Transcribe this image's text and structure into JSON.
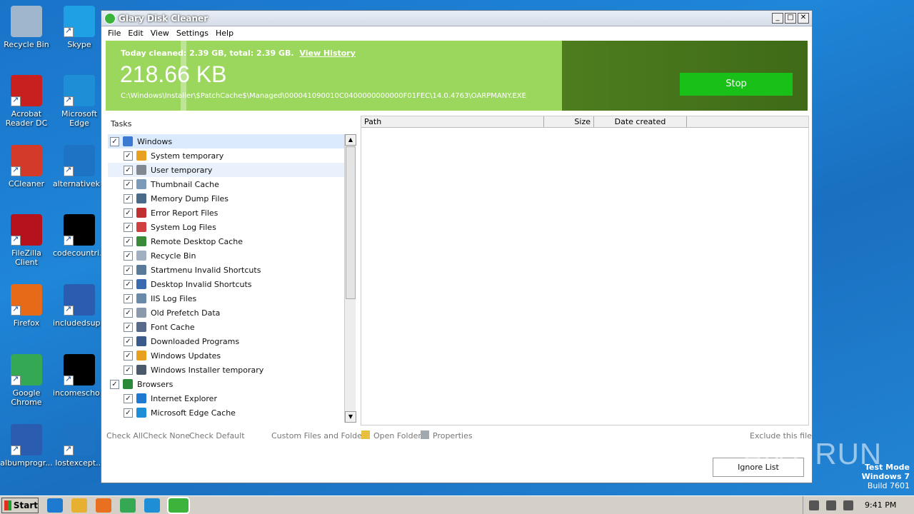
{
  "desktop": {
    "icons": [
      {
        "label": "Recycle Bin",
        "color": "#9fb6cc"
      },
      {
        "label": "Skype",
        "color": "#1fa0e4"
      },
      {
        "label": "Acrobat Reader DC",
        "color": "#c8201e"
      },
      {
        "label": "Microsoft Edge",
        "color": "#1e8fd6"
      },
      {
        "label": "CCleaner",
        "color": "#d43a2a"
      },
      {
        "label": "alternativeki...",
        "color": "#1e74c4"
      },
      {
        "label": "FileZilla Client",
        "color": "#b5121b"
      },
      {
        "label": "codecountri...",
        "color": "#000000"
      },
      {
        "label": "Firefox",
        "color": "#e66a18"
      },
      {
        "label": "includedsup...",
        "color": "#2a5db0"
      },
      {
        "label": "Google Chrome",
        "color": "#34a853"
      },
      {
        "label": "incomescho...",
        "color": "#000000"
      },
      {
        "label": "albumprogr...",
        "color": "#2a5db0"
      },
      {
        "label": "lostexcept...",
        "color": "#1e74c4"
      }
    ]
  },
  "window": {
    "title": "Glary Disk Cleaner",
    "menu": [
      "File",
      "Edit",
      "View",
      "Settings",
      "Help"
    ]
  },
  "banner": {
    "today_text": "Today cleaned: 2.39 GB, total: 2.39 GB.",
    "view_history": "View History",
    "current_size": "218.66 KB",
    "current_path": "C:\\Windows\\Installer\\$PatchCache$\\Managed\\000041090010C0400000000000F01FEC\\14.0.4763\\OARPMANY.EXE",
    "stop_label": "Stop"
  },
  "tasks": {
    "title": "Tasks",
    "items": [
      {
        "label": "Windows",
        "level": 0,
        "checked": "✓",
        "icon_color": "#3a7ad0"
      },
      {
        "label": "System temporary",
        "level": 1,
        "checked": "✓",
        "icon_color": "#e8a020"
      },
      {
        "label": "User temporary",
        "level": 1,
        "checked": "✓",
        "icon_color": "#808890"
      },
      {
        "label": "Thumbnail Cache",
        "level": 1,
        "checked": "✓",
        "icon_color": "#7a9ab8"
      },
      {
        "label": "Memory Dump Files",
        "level": 1,
        "checked": "✓",
        "icon_color": "#4a6a8a"
      },
      {
        "label": "Error Report Files",
        "level": 1,
        "checked": "✓",
        "icon_color": "#c03030"
      },
      {
        "label": "System Log Files",
        "level": 1,
        "checked": "✓",
        "icon_color": "#d04040"
      },
      {
        "label": "Remote Desktop Cache",
        "level": 1,
        "checked": "✓",
        "icon_color": "#3a8a3a"
      },
      {
        "label": "Recycle Bin",
        "level": 1,
        "checked": "✓",
        "icon_color": "#a0b0c0"
      },
      {
        "label": "Startmenu Invalid Shortcuts",
        "level": 1,
        "checked": "✓",
        "icon_color": "#5a7a9a"
      },
      {
        "label": "Desktop Invalid Shortcuts",
        "level": 1,
        "checked": "✓",
        "icon_color": "#3a6ab0"
      },
      {
        "label": "IIS Log Files",
        "level": 1,
        "checked": "✓",
        "icon_color": "#6a8aaa"
      },
      {
        "label": "Old Prefetch Data",
        "level": 1,
        "checked": "✓",
        "icon_color": "#8a9aaa"
      },
      {
        "label": "Font Cache",
        "level": 1,
        "checked": "✓",
        "icon_color": "#5a6a8a"
      },
      {
        "label": "Downloaded Programs",
        "level": 1,
        "checked": "✓",
        "icon_color": "#3a5a8a"
      },
      {
        "label": "Windows Updates",
        "level": 1,
        "checked": "✓",
        "icon_color": "#e8a020"
      },
      {
        "label": "Windows Installer temporary",
        "level": 1,
        "checked": "✓",
        "icon_color": "#4a5a6a"
      },
      {
        "label": "Browsers",
        "level": 0,
        "checked": "✓",
        "icon_color": "#2a8a3a"
      },
      {
        "label": "Internet Explorer",
        "level": 1,
        "checked": "✓",
        "icon_color": "#1e7ad0"
      },
      {
        "label": "Microsoft Edge Cache",
        "level": 1,
        "checked": "✓",
        "icon_color": "#1e8fd6"
      }
    ]
  },
  "file_table": {
    "columns": [
      "Path",
      "Size",
      "Date created"
    ]
  },
  "toolbar": {
    "check_all": "Check All",
    "check_none": "Check None",
    "check_default": "Check Default",
    "custom_files": "Custom Files and Folders",
    "open_folder": "Open Folder",
    "properties": "Properties",
    "exclude": "Exclude this file",
    "ignore_list": "Ignore List"
  },
  "taskbar": {
    "start": "Start",
    "apps": [
      {
        "name": "ie-icon",
        "color": "#1e7ad0"
      },
      {
        "name": "explorer-icon",
        "color": "#e8b030"
      },
      {
        "name": "media-player-icon",
        "color": "#e87020"
      },
      {
        "name": "chrome-icon",
        "color": "#34a853"
      },
      {
        "name": "edge-icon",
        "color": "#1e8fd6"
      },
      {
        "name": "glary-icon",
        "color": "#3cb43c"
      }
    ],
    "clock": "9:41 PM"
  },
  "overlay": {
    "watermark": "ANY RUN",
    "test_mode": "Test Mode",
    "os": "Windows 7",
    "build": "Build 7601"
  }
}
